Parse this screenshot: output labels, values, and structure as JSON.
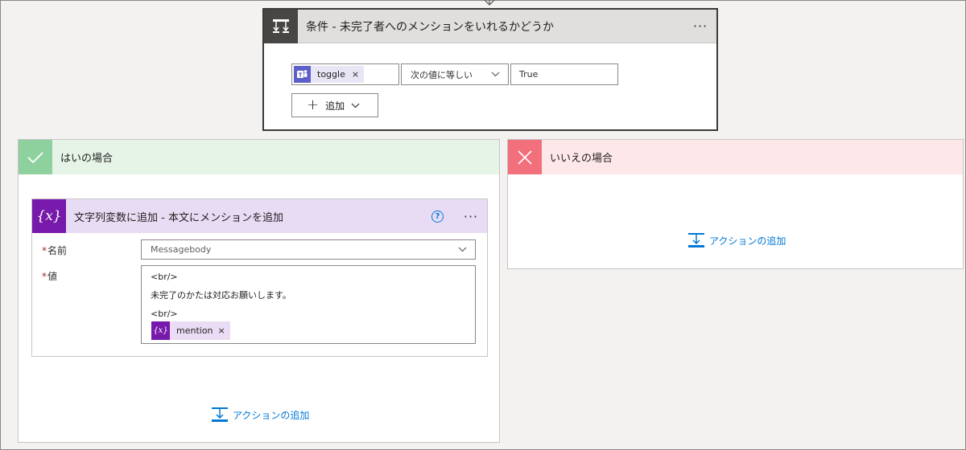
{
  "condition": {
    "title": "条件 - 未完了者へのメンションをいれるかどうか",
    "more": "···",
    "token_label": "toggle",
    "token_remove": "×",
    "operator": "次の値に等しい",
    "value": "True",
    "add_label": "追加"
  },
  "yes_branch": {
    "title": "はいの場合",
    "action": {
      "title": "文字列変数に追加 - 本文にメンションを追加",
      "help": "?",
      "more": "···",
      "name_label": "名前",
      "name_value": "Messagebody",
      "value_label": "値",
      "value_lines": [
        "<br/>",
        "未完了のかたは対応お願いします。",
        "<br/>"
      ],
      "token_icon": "{x}",
      "token_label": "mention",
      "token_remove": "×",
      "required_mark": "*"
    },
    "add_action_label": "アクションの追加"
  },
  "no_branch": {
    "title": "いいえの場合",
    "add_action_label": "アクションの追加"
  },
  "colors": {
    "accent": "#0078d4",
    "yes": "#8fd19e",
    "no": "#f1707b",
    "variable": "#7719aa",
    "teams": "#5b5fc7"
  }
}
